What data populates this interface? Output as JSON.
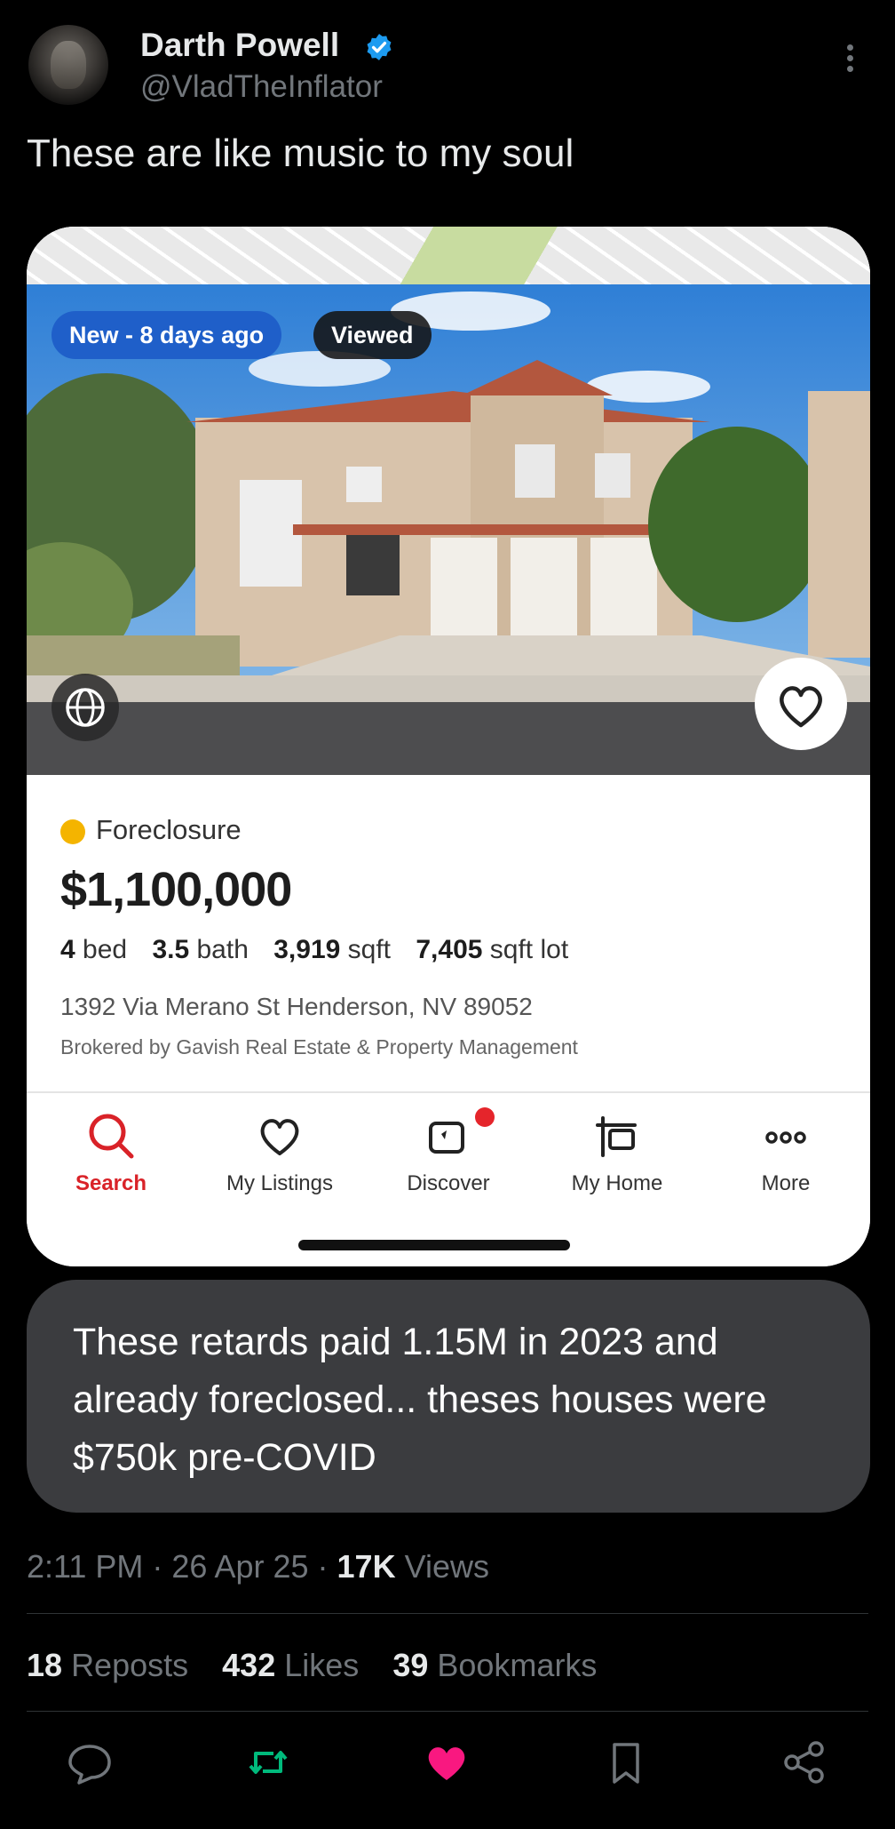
{
  "author": {
    "name": "Darth Powell",
    "handle": "@VladTheInflator",
    "verified_color": "#1d9bf0"
  },
  "tweet": {
    "text": "These are like music to my soul"
  },
  "listing": {
    "badges": {
      "new": "New - 8 days ago",
      "viewed": "Viewed"
    },
    "status": "Foreclosure",
    "status_color": "#f4b400",
    "price": "$1,100,000",
    "specs": {
      "beds_value": "4",
      "beds_unit": "bed",
      "baths_value": "3.5",
      "baths_unit": "bath",
      "sqft_value": "3,919",
      "sqft_unit": "sqft",
      "lot_value": "7,405",
      "lot_unit": "sqft lot"
    },
    "address": "1392 Via Merano St  Henderson, NV 89052",
    "broker": "Brokered by Gavish Real Estate & Property Management"
  },
  "app_tabs": [
    {
      "label": "Search",
      "icon": "search-icon",
      "active": true
    },
    {
      "label": "My Listings",
      "icon": "heart-icon"
    },
    {
      "label": "Discover",
      "icon": "discover-icon",
      "notification": true
    },
    {
      "label": "My Home",
      "icon": "home-sign-icon"
    },
    {
      "label": "More",
      "icon": "more-dots-icon"
    }
  ],
  "accent_color": "#d92228",
  "reply_bubble": {
    "text": "These retards paid 1.15M in 2023 and already foreclosed... theses houses were $750k pre-COVID"
  },
  "meta": {
    "time": "2:11 PM",
    "date": "26 Apr 25",
    "views_count": "17K",
    "views_label": "Views"
  },
  "stats": {
    "reposts_count": "18",
    "reposts_label": "Reposts",
    "likes_count": "432",
    "likes_label": "Likes",
    "bookmarks_count": "39",
    "bookmarks_label": "Bookmarks"
  },
  "actions": {
    "reply_icon": "reply-icon",
    "repost_icon": "repost-icon",
    "repost_color": "#00ba7c",
    "like_icon": "heart-filled-icon",
    "like_color": "#f91880",
    "bookmark_icon": "bookmark-icon",
    "share_icon": "share-icon"
  }
}
